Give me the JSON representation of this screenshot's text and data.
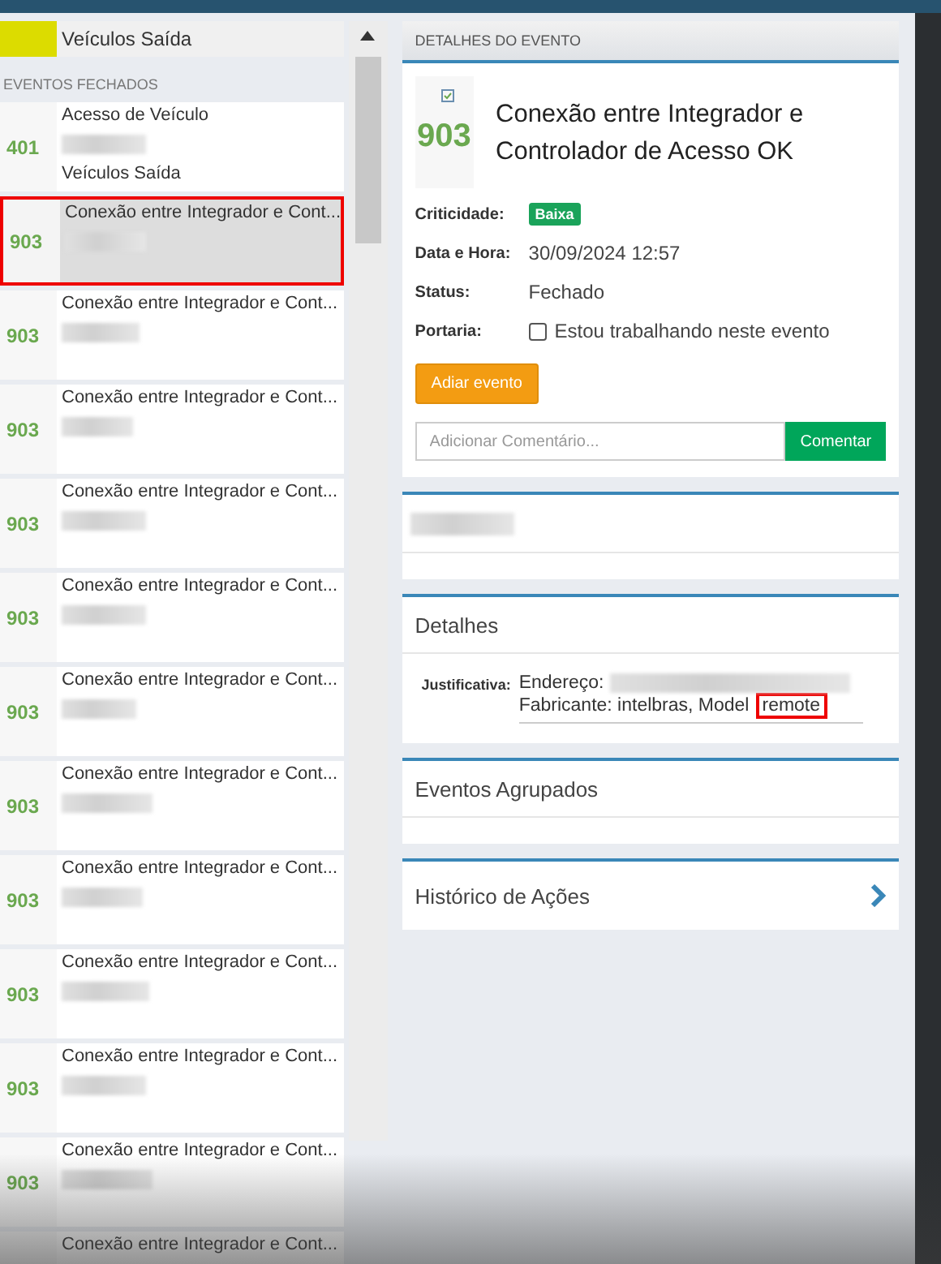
{
  "top_item": {
    "label": "Veículos Saída"
  },
  "section_title": "EVENTOS FECHADOS",
  "events": [
    {
      "code": "401",
      "title": "Acesso de Veículo",
      "subtitle": "Veículos Saída",
      "selected": false
    },
    {
      "code": "903",
      "title": "Conexão entre Integrador e Cont...",
      "selected": true
    },
    {
      "code": "903",
      "title": "Conexão entre Integrador e Cont...",
      "selected": false
    },
    {
      "code": "903",
      "title": "Conexão entre Integrador e Cont...",
      "selected": false
    },
    {
      "code": "903",
      "title": "Conexão entre Integrador e Cont...",
      "selected": false
    },
    {
      "code": "903",
      "title": "Conexão entre Integrador e Cont...",
      "selected": false
    },
    {
      "code": "903",
      "title": "Conexão entre Integrador e Cont...",
      "selected": false
    },
    {
      "code": "903",
      "title": "Conexão entre Integrador e Cont...",
      "selected": false
    },
    {
      "code": "903",
      "title": "Conexão entre Integrador e Cont...",
      "selected": false
    },
    {
      "code": "903",
      "title": "Conexão entre Integrador e Cont...",
      "selected": false
    },
    {
      "code": "903",
      "title": "Conexão entre Integrador e Cont...",
      "selected": false
    },
    {
      "code": "903",
      "title": "Conexão entre Integrador e Cont...",
      "selected": false
    },
    {
      "title": "Conexão entre Integrador e Cont...",
      "selected": false
    }
  ],
  "detail": {
    "header": "DETALHES DO EVENTO",
    "code": "903",
    "title": "Conexão entre Integrador e Controlador de Acesso OK",
    "fields": [
      {
        "kind": "badge",
        "label": "Criticidade:",
        "value": "Baixa"
      },
      {
        "kind": "text",
        "label": "Data e Hora:",
        "value": "30/09/2024 12:57"
      },
      {
        "kind": "text",
        "label": "Status:",
        "value": "Fechado"
      },
      {
        "kind": "checkbox",
        "label": "Portaria:",
        "value": "Estou trabalhando neste evento",
        "checked": false
      }
    ],
    "postpone_button": "Adiar evento",
    "comment": {
      "placeholder": "Adicionar Comentário...",
      "button": "Comentar"
    }
  },
  "panels": [
    {
      "kind": "blank"
    },
    {
      "kind": "details",
      "title": "Detalhes",
      "label": "Justificativa:",
      "lines": [
        {
          "text": "Endereço:",
          "redacted": true
        },
        {
          "text": "Fabricante: intelbras, Model",
          "highlight": "remote"
        }
      ]
    },
    {
      "kind": "section",
      "title": "Eventos Agrupados"
    },
    {
      "kind": "link",
      "title": "Histórico de Ações"
    }
  ]
}
